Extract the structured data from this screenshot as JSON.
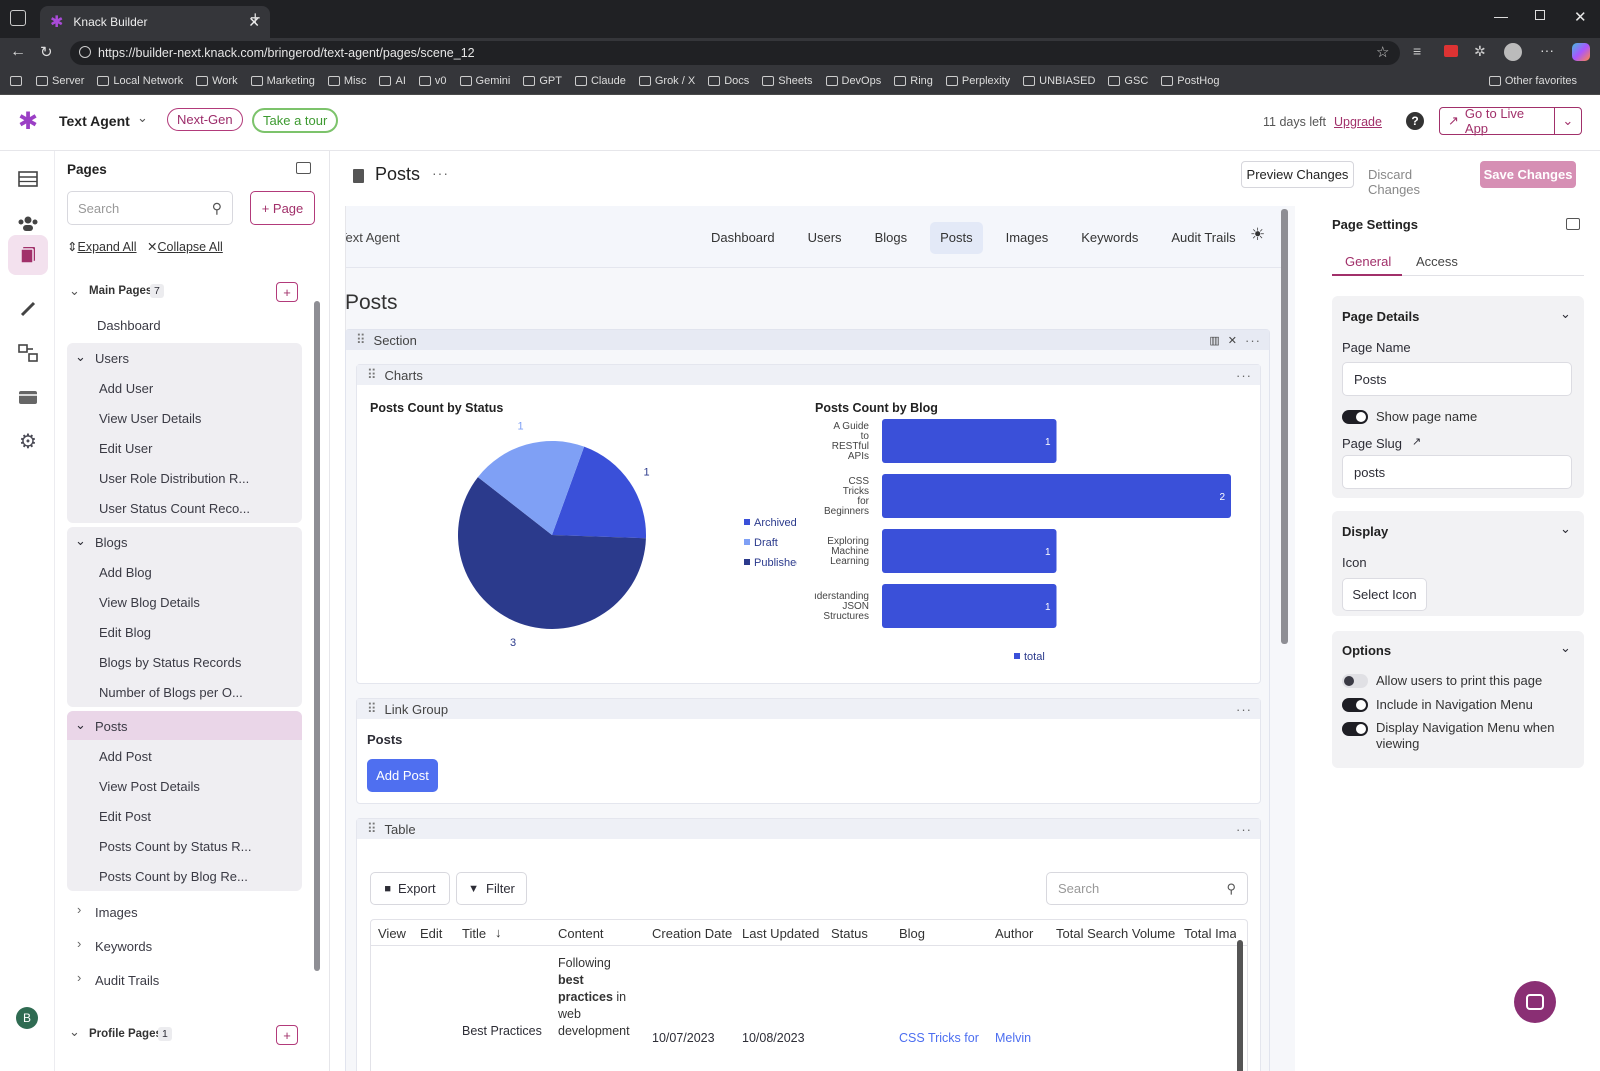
{
  "browser": {
    "tab_title": "Knack Builder",
    "url": "https://builder-next.knack.com/bringerod/text-agent/pages/scene_12",
    "bookmarks": [
      "Server",
      "Local Network",
      "Work",
      "Marketing",
      "Misc",
      "AI",
      "v0",
      "Gemini",
      "GPT",
      "Claude",
      "Grok / X",
      "Docs",
      "Sheets",
      "DevOps",
      "Ring",
      "Perplexity",
      "UNBIASED",
      "GSC",
      "PostHog"
    ],
    "other_favorites": "Other favorites"
  },
  "appbar": {
    "app_name": "Text Agent",
    "next_gen": "Next-Gen",
    "tour": "Take a tour",
    "trial": "11 days left",
    "upgrade": "Upgrade",
    "live_app": "Go to Live App"
  },
  "pages_panel": {
    "title": "Pages",
    "search_placeholder": "Search",
    "add_page": "+ Page",
    "expand_all": "Expand All",
    "collapse_all": "Collapse All",
    "main_pages": "Main Pages",
    "main_count": "7",
    "dashboard": "Dashboard",
    "users": {
      "label": "Users",
      "items": [
        "Add User",
        "View User Details",
        "Edit User",
        "User Role Distribution R...",
        "User Status Count Reco..."
      ]
    },
    "blogs": {
      "label": "Blogs",
      "items": [
        "Add Blog",
        "View Blog Details",
        "Edit Blog",
        "Blogs by Status Records",
        "Number of Blogs per O..."
      ]
    },
    "posts": {
      "label": "Posts",
      "items": [
        "Add Post",
        "View Post Details",
        "Edit Post",
        "Posts Count by Status R...",
        "Posts Count by Blog Re..."
      ]
    },
    "images": "Images",
    "keywords": "Keywords",
    "audit": "Audit Trails",
    "profile_pages": "Profile Pages",
    "profile_count": "1",
    "avatar": "B"
  },
  "page_header": {
    "title": "Posts",
    "preview": "Preview Changes",
    "discard": "Discard Changes",
    "save": "Save Changes"
  },
  "preview_nav": {
    "app_name": "Text Agent",
    "items": [
      "Dashboard",
      "Users",
      "Blogs",
      "Posts",
      "Images",
      "Keywords",
      "Audit Trails"
    ],
    "active": "Posts"
  },
  "canvas": {
    "page_heading": "Posts",
    "section": "Section",
    "charts": "Charts",
    "link_group": "Link Group",
    "link_title": "Posts",
    "add_post": "Add Post",
    "table": "Table",
    "export": "Export",
    "filter": "Filter",
    "table_search": "Search",
    "columns": [
      "View",
      "Edit",
      "Title",
      "Content",
      "Creation Date",
      "Last Updated",
      "Status",
      "Blog",
      "Author",
      "Total Search Volume",
      "Total Ima"
    ],
    "row": {
      "title": "Best Practices",
      "content_lines": [
        "Following",
        "best",
        "practices",
        "in",
        "web",
        "development"
      ],
      "creation": "10/07/2023",
      "updated": "10/08/2023",
      "blog": "CSS Tricks for",
      "author": "Melvin"
    }
  },
  "chart_data": [
    {
      "type": "pie",
      "title": "Posts Count by Status",
      "categories": [
        "Archived",
        "Draft",
        "Published"
      ],
      "values": [
        1,
        1,
        3
      ],
      "colors": [
        "#3a50d9",
        "#7fa0f5",
        "#2b3a8c"
      ],
      "legend": "right"
    },
    {
      "type": "bar",
      "orientation": "horizontal",
      "title": "Posts Count by Blog",
      "categories": [
        "A Guide to RESTful APIs",
        "CSS Tricks for Beginners",
        "Exploring Machine Learning",
        "Understanding JSON Structures"
      ],
      "category_labels": [
        [
          "A Guide",
          "to",
          "RESTful",
          "APIs"
        ],
        [
          "CSS",
          "Tricks",
          "for",
          "Beginners"
        ],
        [
          "Exploring",
          "Machine",
          "Learning"
        ],
        [
          "ıderstanding",
          "JSON",
          "Structures"
        ]
      ],
      "series": [
        {
          "name": "total",
          "values": [
            1,
            2,
            1,
            1
          ]
        }
      ],
      "xlim": [
        0,
        2
      ],
      "color": "#3a50d9",
      "legend": "bottom"
    }
  ],
  "settings": {
    "title": "Page Settings",
    "tab_general": "General",
    "tab_access": "Access",
    "details": "Page Details",
    "page_name_label": "Page Name",
    "page_name": "Posts",
    "show_name": "Show page name",
    "slug_label": "Page Slug",
    "slug": "posts",
    "display": "Display",
    "icon_label": "Icon",
    "select_icon": "Select Icon",
    "options": "Options",
    "opt_print": "Allow users to print this page",
    "opt_nav": "Include in Navigation Menu",
    "opt_display_nav": "Display Navigation Menu when viewing"
  }
}
